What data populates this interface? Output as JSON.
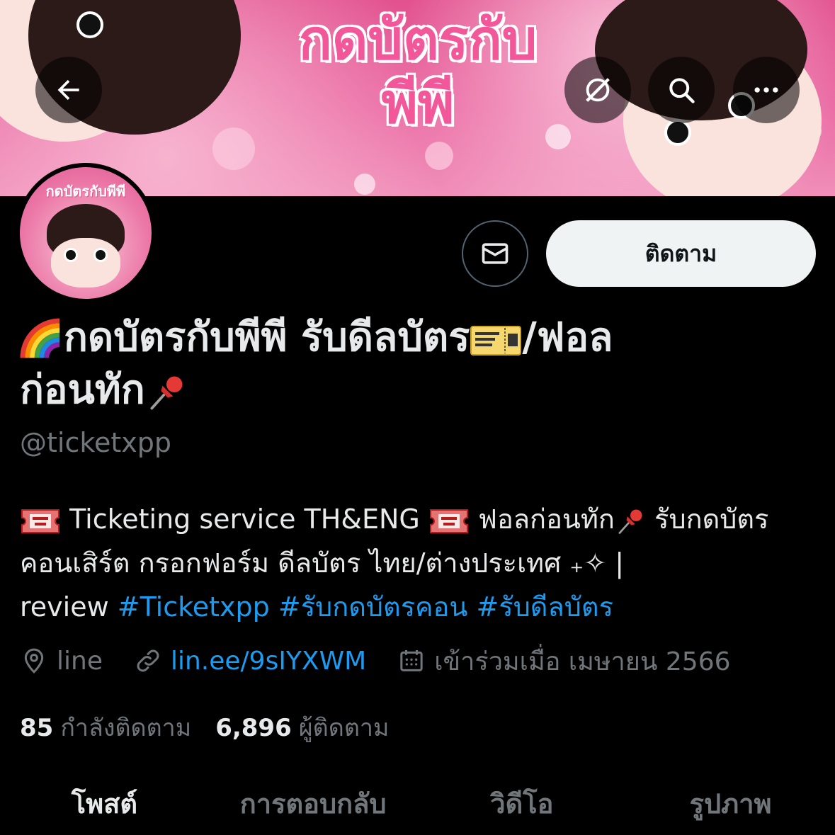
{
  "header": {
    "back_icon": "arrow-left-icon",
    "grok_icon": "grok-icon",
    "search_icon": "search-icon",
    "more_icon": "more-icon"
  },
  "banner": {
    "title_line1": "กดบัตรกับ",
    "title_line2": "พีพี"
  },
  "avatar": {
    "label": "กดบัตรกับพีพี"
  },
  "actions": {
    "message_icon": "envelope-icon",
    "follow_label": "ติดตาม"
  },
  "profile": {
    "display_name_part1": "กดบัตรกับพีพี รับดีลบัตร",
    "display_name_part2": "/ฟอล",
    "display_name_part3": "ก่อนทัก",
    "handle": "@ticketxpp",
    "bio": {
      "part1": "Ticketing service TH&ENG",
      "part2": "ฟอลก่อนทัก",
      "part3": "รับกดบัตรคอนเสิร์ต กรอกฟอร์ม ดีลบัตร ไทย/ต่างประเทศ ₊✧ |",
      "part4": "review",
      "hashtags": [
        "#Ticketxpp",
        "#รับกดบัตรคอน",
        "#รับดีลบัตร"
      ]
    },
    "location": "line",
    "website": "lin.ee/9sIYXWM",
    "joined": "เข้าร่วมเมื่อ เมษายน 2566"
  },
  "stats": {
    "following_count": "85",
    "following_label": "กำลังติดตาม",
    "followers_count": "6,896",
    "followers_label": "ผู้ติดตาม"
  },
  "tabs": [
    {
      "label": "โพสต์",
      "active": true
    },
    {
      "label": "การตอบกลับ",
      "active": false
    },
    {
      "label": "วิดีโอ",
      "active": false
    },
    {
      "label": "รูปภาพ",
      "active": false
    }
  ],
  "colors": {
    "accent": "#1d9bf0",
    "banner_pink": "#e2528f",
    "background": "#000000",
    "follow_button": "#eff3f4"
  }
}
